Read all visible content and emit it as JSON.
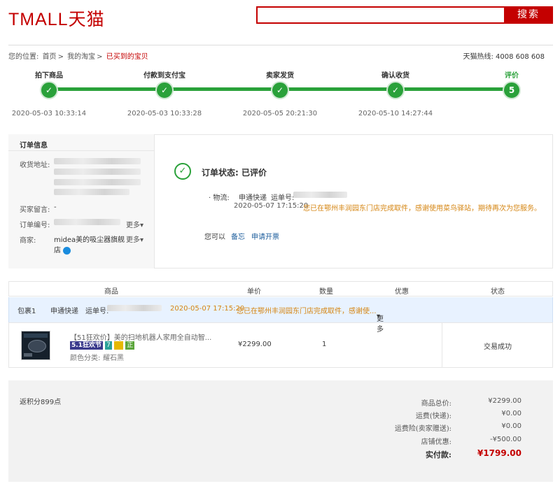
{
  "header": {
    "logo_text": "TMALL天猫",
    "search_placeholder": "",
    "search_button": "搜索",
    "brand_color": "#c40000"
  },
  "breadcrumb": {
    "prefix": "您的位置:",
    "items": [
      "首页",
      "我的淘宝",
      "已买到的宝贝"
    ],
    "separator": ">"
  },
  "hotline": "天猫热线:  4008 608 608",
  "steps": [
    {
      "label": "拍下商品",
      "time": "2020-05-03 10:33:14",
      "mark": "✓"
    },
    {
      "label": "付款到支付宝",
      "time": "2020-05-03 10:33:28",
      "mark": "✓"
    },
    {
      "label": "卖家发货",
      "time": "2020-05-05 20:21:30",
      "mark": "✓"
    },
    {
      "label": "确认收货",
      "time": "2020-05-10 14:27:44",
      "mark": "✓"
    },
    {
      "label": "评价",
      "time": "",
      "mark": "5"
    }
  ],
  "order_info": {
    "title": "订单信息",
    "address_label": "收货地址:",
    "message_label": "买家留言:",
    "message_value": "-",
    "order_no_label": "订单编号:",
    "merchant_label": "商家:",
    "merchant_name_line1": "midea美的吸尘器旗舰",
    "merchant_name_line2": "店",
    "more": "更多"
  },
  "status": {
    "title": "订单状态: 已评价",
    "logistics_label": "· 物流:",
    "courier": "申通快递",
    "tracking_label": "运单号:",
    "event_time": "2020-05-07 17:15:20",
    "event_text": "您已在鄂州丰润园东门店完成取件，感谢使用菜鸟驿站，期待再次为您服务。",
    "you_can": "您可以",
    "actions": [
      "备忘",
      "申请开票"
    ]
  },
  "table": {
    "headers": [
      "商品",
      "单价",
      "数量",
      "优惠",
      "状态"
    ],
    "package": {
      "name": "包裹1",
      "courier": "申通快递",
      "tracking_label": "运单号:",
      "time": "2020-05-07 17:15:20",
      "text": "您已在鄂州丰润园东门店完成取件，感谢使...",
      "more": "更多"
    },
    "item": {
      "title": "【51狂欢价】美的扫地机器人家用全自动智...",
      "badge1": "5.1狂欢节",
      "badge2": "7",
      "badge4": "正",
      "color_label": "颜色分类:",
      "color_value": "耀石黑",
      "price": "¥2299.00",
      "qty": "1",
      "discount": "",
      "status": "交易成功"
    }
  },
  "summary": {
    "points": "返积分899点",
    "rows": [
      {
        "label": "商品总价:",
        "value": "¥2299.00"
      },
      {
        "label": "运费(快递):",
        "value": "¥0.00"
      },
      {
        "label": "运费险(卖家赠送):",
        "value": "¥0.00"
      },
      {
        "label": "店铺优惠:",
        "value": "-¥500.00"
      }
    ],
    "total_label": "实付款:",
    "total_value": "¥1799.00"
  }
}
